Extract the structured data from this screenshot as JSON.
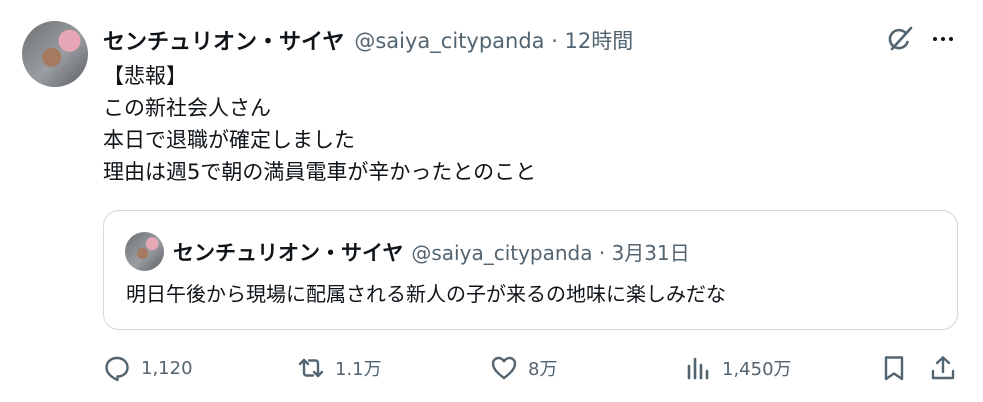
{
  "tweet": {
    "author_name": "センチュリオン・サイヤ",
    "meta": "@saiya_citypanda · 12時間",
    "lines": [
      "【悲報】",
      "この新社会人さん",
      "本日で退職が確定しました",
      "理由は週5で朝の満員電車が辛かったとのこと"
    ]
  },
  "quote": {
    "author_name": "センチュリオン・サイヤ",
    "meta": "@saiya_citypanda · 3月31日",
    "text": "明日午後から現場に配属される新人の子が来るの地味に楽しみだな"
  },
  "actions": {
    "replies": "1,120",
    "reposts": "1.1万",
    "likes": "8万",
    "views": "1,450万"
  },
  "colors": {
    "text": "#0f1419",
    "secondary": "#536471",
    "border": "#cfd9de"
  }
}
